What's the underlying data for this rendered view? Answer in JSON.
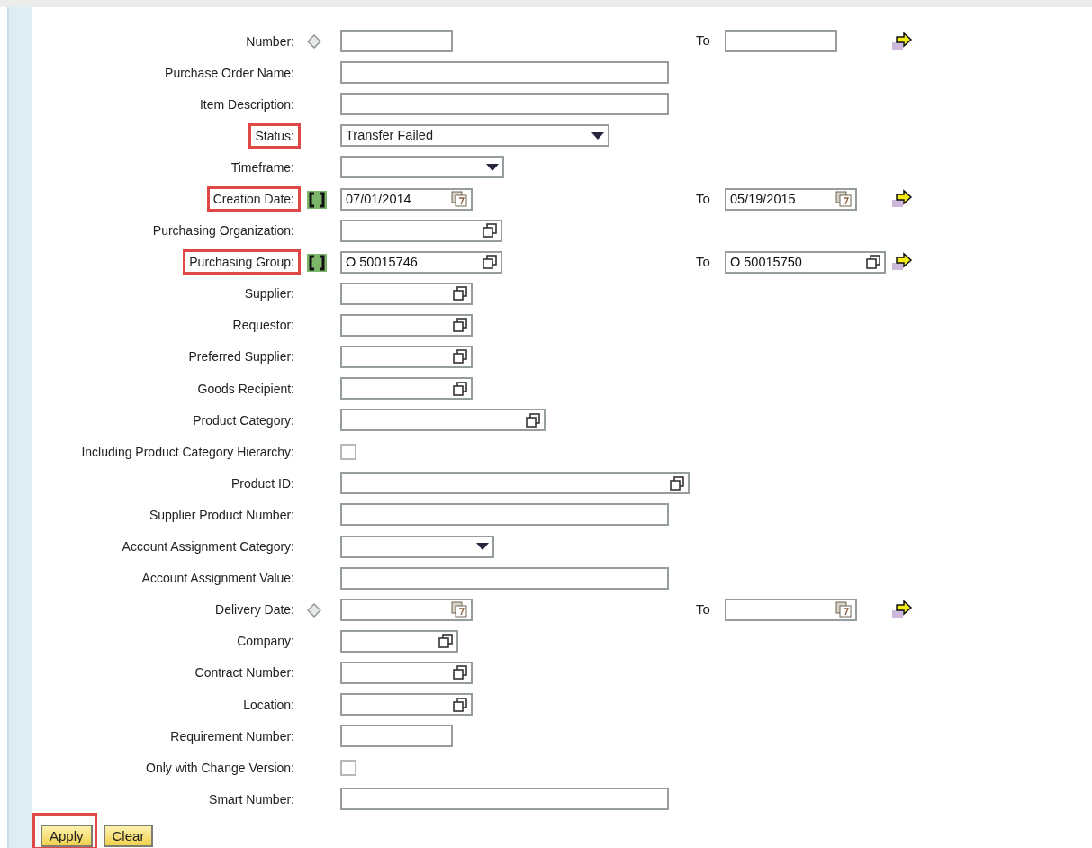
{
  "filters": [
    {
      "label": "Number:",
      "highlighted": false,
      "interval_option": false,
      "kind": "text",
      "range": {
        "to_label": "To",
        "kind": "text"
      }
    },
    {
      "label": "Purchase Order Name:",
      "highlighted": false,
      "kind": "text"
    },
    {
      "label": "Item Description:",
      "highlighted": false,
      "kind": "text"
    },
    {
      "label": "Status:",
      "highlighted": true,
      "kind": "select",
      "value": "Transfer Failed"
    },
    {
      "label": "Timeframe:",
      "highlighted": false,
      "kind": "select"
    },
    {
      "label": "Creation Date:",
      "highlighted": true,
      "interval_option": true,
      "kind": "date",
      "value": "07/01/2014",
      "range": {
        "to_label": "To",
        "kind": "date",
        "value": "05/19/2015"
      }
    },
    {
      "label": "Purchasing Organization:",
      "highlighted": false,
      "kind": "lookup"
    },
    {
      "label": "Purchasing Group:",
      "highlighted": true,
      "interval_option": true,
      "kind": "lookup",
      "value": "O 50015746",
      "range": {
        "to_label": "To",
        "kind": "lookup",
        "value": "O 50015750"
      }
    },
    {
      "label": "Supplier:",
      "highlighted": false,
      "kind": "lookup"
    },
    {
      "label": "Requestor:",
      "highlighted": false,
      "kind": "lookup"
    },
    {
      "label": "Preferred Supplier:",
      "highlighted": false,
      "kind": "lookup"
    },
    {
      "label": "Goods Recipient:",
      "highlighted": false,
      "kind": "lookup"
    },
    {
      "label": "Product Category:",
      "highlighted": false,
      "kind": "lookup"
    },
    {
      "label": "Including Product Category Hierarchy:",
      "highlighted": false,
      "kind": "checkbox",
      "checked": false
    },
    {
      "label": "Product ID:",
      "highlighted": false,
      "kind": "lookup"
    },
    {
      "label": "Supplier Product Number:",
      "highlighted": false,
      "kind": "text"
    },
    {
      "label": "Account Assignment Category:",
      "highlighted": false,
      "kind": "select"
    },
    {
      "label": "Account Assignment Value:",
      "highlighted": false,
      "kind": "text"
    },
    {
      "label": "Delivery Date:",
      "highlighted": false,
      "interval_option": false,
      "kind": "date",
      "range": {
        "to_label": "To",
        "kind": "date"
      }
    },
    {
      "label": "Company:",
      "highlighted": false,
      "kind": "lookup"
    },
    {
      "label": "Contract Number:",
      "highlighted": false,
      "kind": "lookup"
    },
    {
      "label": "Location:",
      "highlighted": false,
      "kind": "lookup"
    },
    {
      "label": "Requirement Number:",
      "highlighted": false,
      "kind": "text"
    },
    {
      "label": "Only with Change Version:",
      "highlighted": false,
      "kind": "checkbox",
      "checked": false
    },
    {
      "label": "Smart Number:",
      "highlighted": false,
      "kind": "text"
    }
  ],
  "buttons": [
    {
      "label": "Apply",
      "highlighted": true
    },
    {
      "label": "Clear",
      "highlighted": false
    }
  ]
}
